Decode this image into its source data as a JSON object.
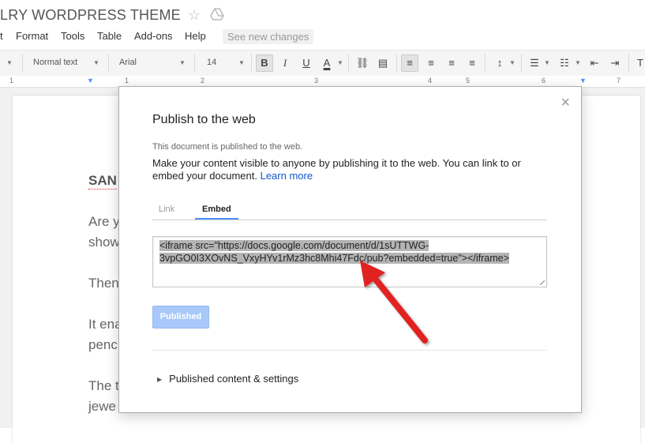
{
  "app": {
    "doc_title": "LRY WORDPRESS THEME",
    "menus": [
      "t",
      "Format",
      "Tools",
      "Table",
      "Add-ons",
      "Help"
    ],
    "see_changes": "See new changes"
  },
  "toolbar": {
    "style": "Normal text",
    "font": "Arial",
    "size": "14"
  },
  "ruler": {
    "numbers": [
      "1",
      "1",
      "2",
      "3",
      "4",
      "5",
      "6",
      "7"
    ]
  },
  "document": {
    "heading": "SAN",
    "lines": [
      "Are y",
      "show",
      "Then",
      "It ena",
      "penc",
      "The t",
      "jewe"
    ]
  },
  "dialog": {
    "title": "Publish to the web",
    "status": "This document is published to the web.",
    "description": "Make your content visible to anyone by publishing it to the web. You can link to or embed your document.",
    "learn_more": "Learn more",
    "tabs": {
      "link": "Link",
      "embed": "Embed",
      "active": "Embed"
    },
    "embed_code": "<iframe src=\"https://docs.google.com/document/d/1sUTTWG-3vpGO0I3XOvNS_VxyHYv1rMz3hc8Mhi47Fdc/pub?embedded=true\"></iframe>",
    "embed_line1": "<iframe src=\"https://docs.google.com/document/d/1sUTTWG-",
    "embed_line2": "3vpGO0I3XOvNS_VxyHYv1rMz3hc8Mhi47Fdc/pub?embedded=true\"></iframe>",
    "published_button": "Published",
    "settings_label": "Published content & settings"
  },
  "colors": {
    "accent": "#4d90fe",
    "link": "#1155cc",
    "arrow": "#e02020"
  },
  "icons": [
    "star-icon",
    "drive-icon",
    "close-icon",
    "expand-triangle-icon"
  ]
}
